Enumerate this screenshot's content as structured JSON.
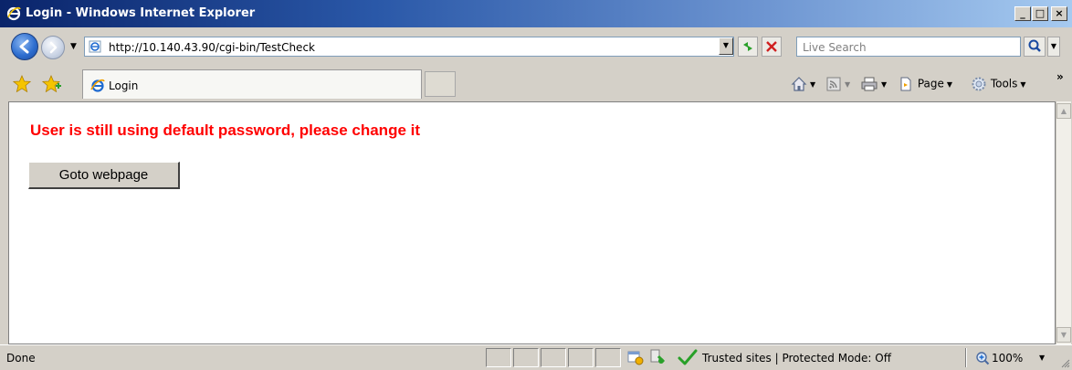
{
  "window": {
    "title": "Login - Windows Internet Explorer",
    "minimize_label": "_",
    "maximize_label": "□",
    "close_label": "×"
  },
  "address_bar": {
    "url": "http://10.140.43.90/cgi-bin/TestCheck"
  },
  "search": {
    "placeholder": "Live Search"
  },
  "tabs": [
    {
      "label": "Login"
    }
  ],
  "command_bar": {
    "page_label": "Page",
    "tools_label": "Tools",
    "overflow_label": "»"
  },
  "content": {
    "message": "User is still using default password, please change it",
    "goto_button_label": "Goto webpage",
    "message_color": "#ff0000"
  },
  "status_bar": {
    "status": "Done",
    "zone": "Trusted sites | Protected Mode: Off",
    "zoom": "100%"
  },
  "colors": {
    "titlebar_start": "#0a246a",
    "chrome": "#d4d0c8"
  },
  "icons": [
    "ie-logo-icon",
    "back-icon",
    "forward-icon",
    "page-icon",
    "refresh-icon",
    "stop-icon",
    "search-icon",
    "favorites-star-icon",
    "add-favorites-icon",
    "home-icon",
    "feeds-icon",
    "print-icon",
    "page-menu-icon",
    "tools-gear-icon",
    "popup-blocker-icon",
    "security-icon",
    "trusted-check-icon",
    "zoom-icon",
    "resize-grip-icon"
  ]
}
